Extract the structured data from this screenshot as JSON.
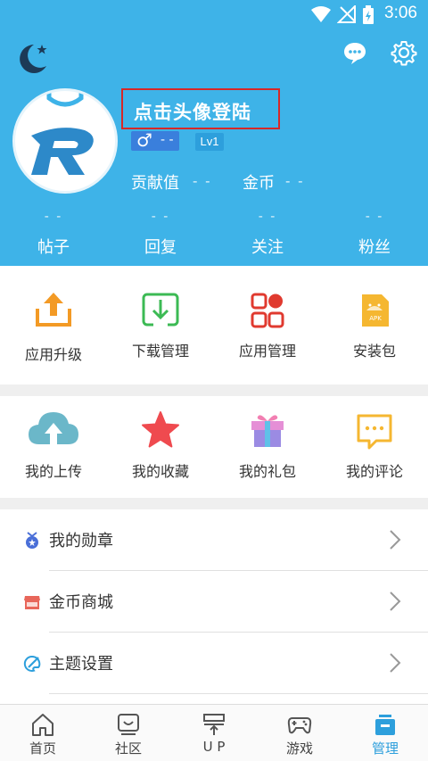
{
  "status": {
    "time": "3:06"
  },
  "profile": {
    "login_prompt": "点击头像登陆",
    "gender_value": "- -",
    "level": "Lv1",
    "contribution_label": "贡献值",
    "contribution_value": "- -",
    "coins_label": "金币",
    "coins_value": "- -"
  },
  "counters": [
    {
      "num": "- -",
      "label": "帖子"
    },
    {
      "num": "- -",
      "label": "回复"
    },
    {
      "num": "- -",
      "label": "关注"
    },
    {
      "num": "- -",
      "label": "粉丝"
    }
  ],
  "grid1": [
    {
      "label": "应用升级",
      "icon": "upload-tray-icon"
    },
    {
      "label": "下载管理",
      "icon": "download-tray-icon"
    },
    {
      "label": "应用管理",
      "icon": "apps-grid-icon"
    },
    {
      "label": "安装包",
      "icon": "apk-file-icon"
    }
  ],
  "grid2": [
    {
      "label": "我的上传",
      "icon": "cloud-upload-icon"
    },
    {
      "label": "我的收藏",
      "icon": "star-icon"
    },
    {
      "label": "我的礼包",
      "icon": "gift-icon"
    },
    {
      "label": "我的评论",
      "icon": "comment-icon"
    }
  ],
  "list": [
    {
      "label": "我的勋章",
      "icon": "medal-icon"
    },
    {
      "label": "金币商城",
      "icon": "shop-icon"
    },
    {
      "label": "主题设置",
      "icon": "palette-icon"
    }
  ],
  "tabs": [
    {
      "label": "首页",
      "icon": "home-icon"
    },
    {
      "label": "社区",
      "icon": "community-icon"
    },
    {
      "label": "U P",
      "icon": "up-icon"
    },
    {
      "label": "游戏",
      "icon": "gamepad-icon"
    },
    {
      "label": "管理",
      "icon": "manage-icon",
      "active": true
    }
  ],
  "colors": {
    "header": "#3eb3e8",
    "accent": "#2d9fdc",
    "highlight_box": "#d62828"
  }
}
